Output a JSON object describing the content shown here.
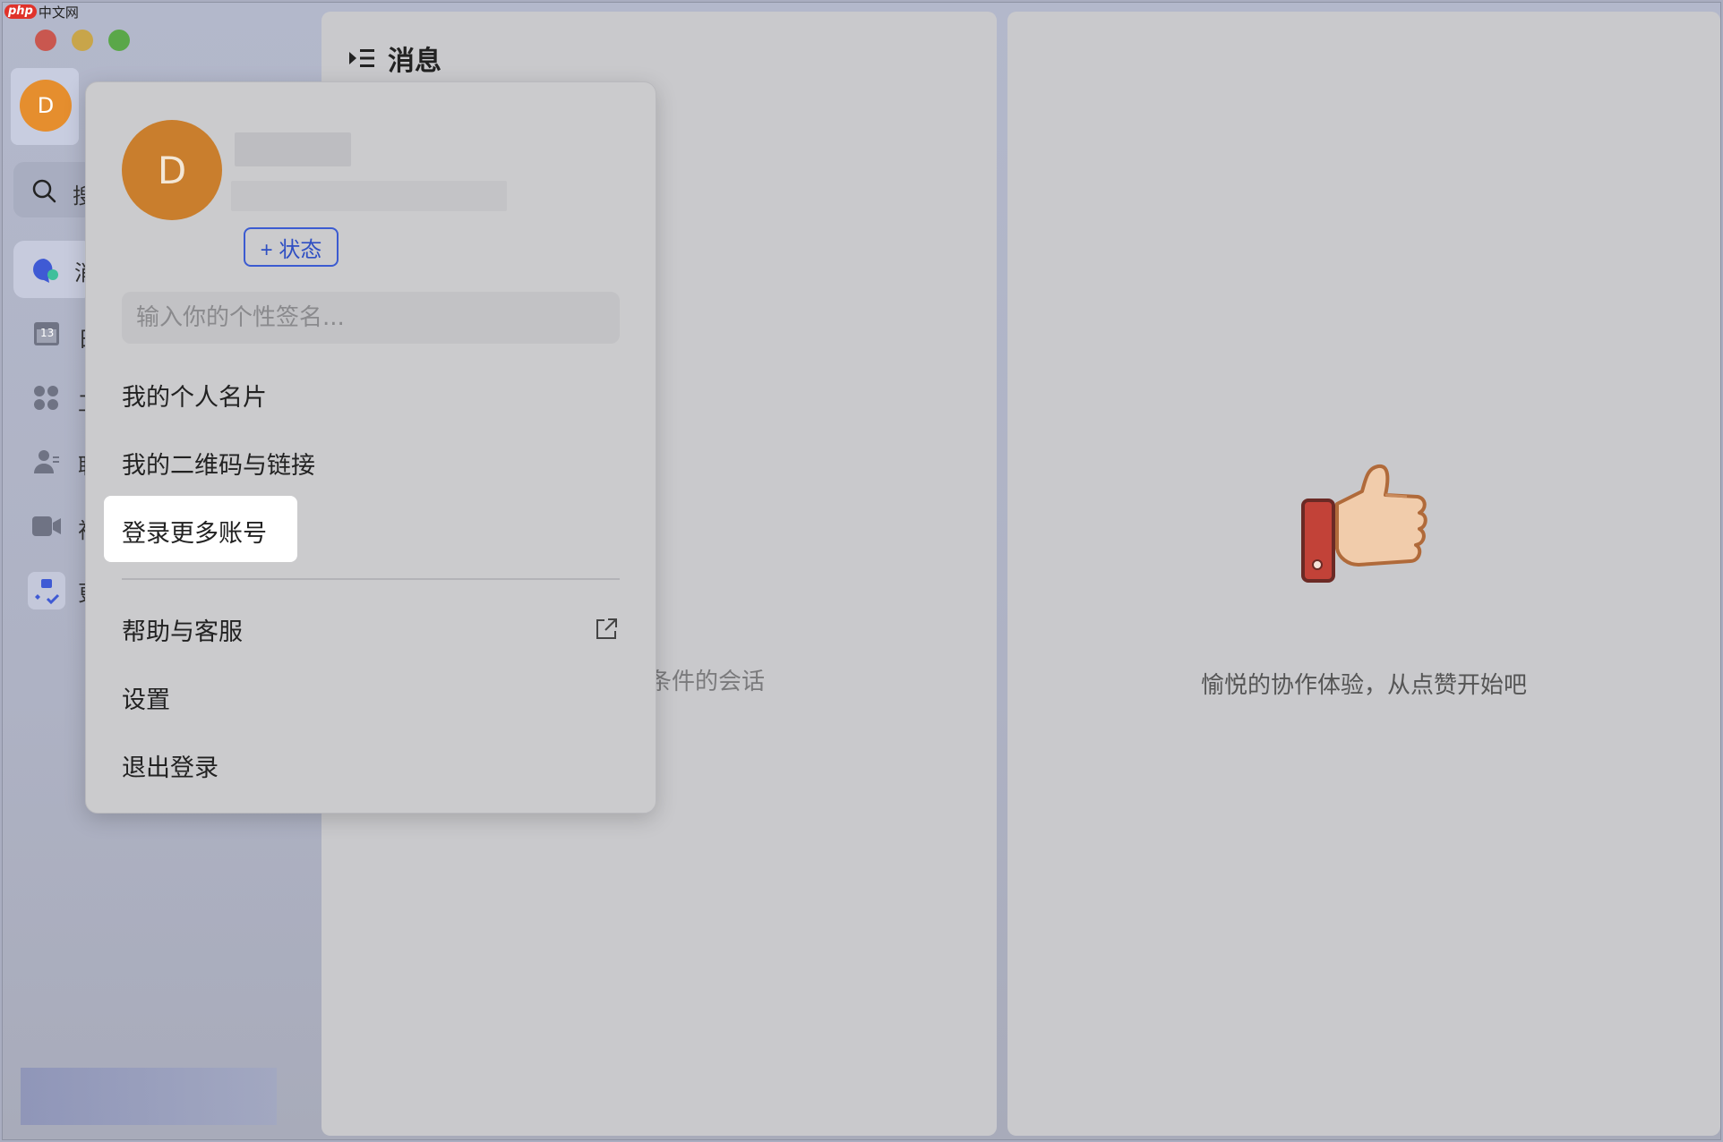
{
  "watermark": {
    "badge": "php",
    "text": "中文网"
  },
  "sidebar": {
    "avatar_letter": "D",
    "search_cut": "搜",
    "nav_cuts": [
      "消",
      "日",
      "工",
      "联",
      "视",
      "更"
    ],
    "calendar_day": "13"
  },
  "message_panel": {
    "title": "消息",
    "empty_text": "条件的会话"
  },
  "right_panel": {
    "caption": "愉悦的协作体验，从点赞开始吧"
  },
  "popup": {
    "avatar_letter": "D",
    "status_label": "+ 状态",
    "signature_placeholder": "输入你的个性签名...",
    "menu": {
      "profile_card": "我的个人名片",
      "qr_link": "我的二维码与链接",
      "add_account": "登录更多账号",
      "help": "帮助与客服",
      "settings": "设置",
      "logout": "退出登录"
    }
  },
  "colors": {
    "accent": "#3b5bd1",
    "avatar": "#e58e2e",
    "highlight": "#ffffff"
  }
}
